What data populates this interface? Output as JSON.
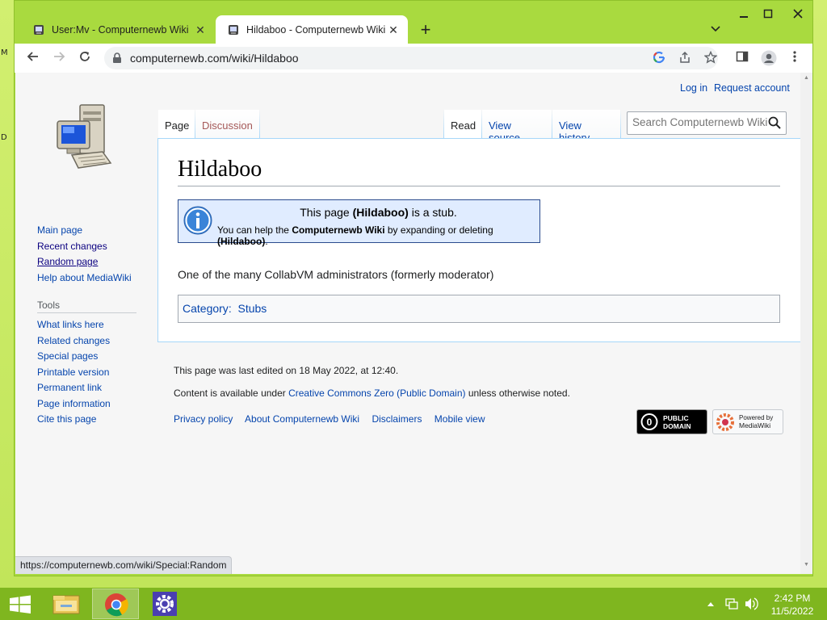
{
  "desktop": {
    "fragment_1": "M",
    "fragment_2": "D"
  },
  "browser": {
    "tabs": [
      {
        "title": "User:Mv - Computernewb Wiki",
        "close": "✕"
      },
      {
        "title": "Hildaboo - Computernewb Wiki",
        "close": "✕"
      }
    ],
    "new_tab": "+",
    "url": "computernewb.com/wiki/Hildaboo",
    "status_url": "https://computernewb.com/wiki/Special:Random"
  },
  "wiki": {
    "personal": {
      "login": "Log in",
      "request": "Request account"
    },
    "nav": [
      {
        "label": "Main page"
      },
      {
        "label": "Recent changes"
      },
      {
        "label": "Random page"
      },
      {
        "label": "Help about MediaWiki"
      }
    ],
    "tools_heading": "Tools",
    "tools": [
      {
        "label": "What links here"
      },
      {
        "label": "Related changes"
      },
      {
        "label": "Special pages"
      },
      {
        "label": "Printable version"
      },
      {
        "label": "Permanent link"
      },
      {
        "label": "Page information"
      },
      {
        "label": "Cite this page"
      }
    ],
    "tabs": {
      "page": "Page",
      "discussion": "Discussion",
      "read": "Read",
      "view_source": "View source",
      "view_history": "View history"
    },
    "search_placeholder": "Search Computernewb Wiki",
    "title": "Hildaboo",
    "stub": {
      "l1_a": "This page ",
      "l1_b": "(Hildaboo)",
      "l1_c": " is a stub.",
      "l2_a": "You can help the ",
      "l2_b": "Computernewb Wiki",
      "l2_c": " by expanding or deleting ",
      "l2_d": "(Hildaboo)",
      "l2_e": "."
    },
    "body": "One of the many CollabVM administrators (formerly moderator)",
    "category_label": "Category",
    "category_sep": ":",
    "category": "Stubs",
    "footer": {
      "last_edited": "This page was last edited on 18 May 2022, at 12:40.",
      "license_a": "Content is available under ",
      "license_link": "Creative Commons Zero (Public Domain)",
      "license_b": " unless otherwise noted.",
      "links": [
        "Privacy policy",
        "About Computernewb Wiki",
        "Disclaimers",
        "Mobile view"
      ],
      "badge_pd_1": "PUBLIC",
      "badge_pd_2": "DOMAIN",
      "badge_pd_glyph": "0",
      "badge_mw_1": "Powered by",
      "badge_mw_2": "MediaWiki"
    }
  },
  "taskbar": {
    "time": "2:42 PM",
    "date": "11/5/2022"
  },
  "colors": {
    "accent": "#a9da3f",
    "taskbar": "#7fb61f",
    "link": "#0645ad"
  }
}
